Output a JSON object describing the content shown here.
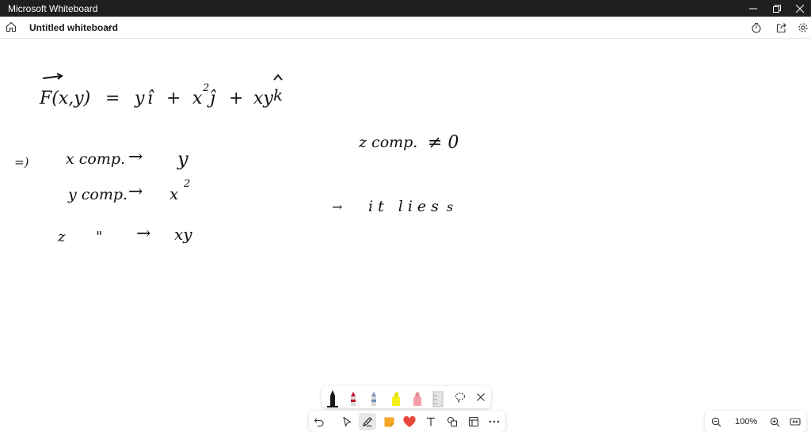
{
  "window": {
    "app_title": "Microsoft Whiteboard"
  },
  "appbar": {
    "board_title": "Untitled whiteboard"
  },
  "colors": {
    "titlebar_bg": "#1f1f1f",
    "ink": "#111111",
    "pen_black": "#1a1a1a",
    "pen_red": "#c0142b",
    "pen_blue": "#6f8fb8",
    "pen_yellow": "#f4f01a",
    "pen_pink": "#f2a0aa",
    "tray_grey": "#bdbdbd",
    "heart_red": "#e8463d",
    "note_orange": "#f5a623"
  },
  "icons": {
    "window": [
      "minimize-icon",
      "restore-icon",
      "close-icon"
    ],
    "appbar": [
      "home-icon",
      "chevron-down-icon",
      "timer-icon",
      "share-icon",
      "settings-icon"
    ],
    "pen_tray": [
      "lasso-icon",
      "close-icon"
    ],
    "toolbar": [
      "undo-icon",
      "select-icon",
      "pen-icon",
      "sticky-note-icon",
      "reaction-heart-icon",
      "text-icon",
      "shapes-icon",
      "templates-icon",
      "more-icon"
    ],
    "zoom": [
      "zoom-out-icon",
      "zoom-in-icon",
      "fit-to-screen-icon"
    ]
  },
  "pens": [
    {
      "name": "black",
      "color": "#1a1a1a",
      "selected": true
    },
    {
      "name": "red",
      "color": "#c0142b",
      "selected": false
    },
    {
      "name": "blue",
      "color": "#6f8fb8",
      "selected": false
    },
    {
      "name": "yellow-highlighter",
      "color": "#f4f01a",
      "selected": false
    },
    {
      "name": "pink-highlighter",
      "color": "#f2a0aa",
      "selected": false
    },
    {
      "name": "ruler",
      "color": "#bdbdbd",
      "selected": false
    }
  ],
  "zoom": {
    "level": "100%"
  },
  "canvas": {
    "line1": {
      "lhs": "F(x,y)",
      "eq": "=",
      "t1": "y",
      "hat_i": "î",
      "plus1": "+",
      "t2": "x",
      "exp2": "2",
      "hat_j": "ĵ",
      "plus2": "+",
      "t3": "xy",
      "hat_k": "k"
    },
    "row_x": {
      "bullet": "=)",
      "label": "x comp.",
      "arrow": "→",
      "value": "y"
    },
    "row_y": {
      "label": "y comp.",
      "arrow": "→",
      "value": "x",
      "exp": "2"
    },
    "row_z": {
      "label": "z",
      "ditto": "\"",
      "arrow": "→",
      "value": "xy"
    },
    "right1": {
      "label": "z comp.",
      "value": "≠ 0"
    },
    "right2": {
      "arrow": "→",
      "text": "it lies",
      "tail": "s"
    }
  }
}
